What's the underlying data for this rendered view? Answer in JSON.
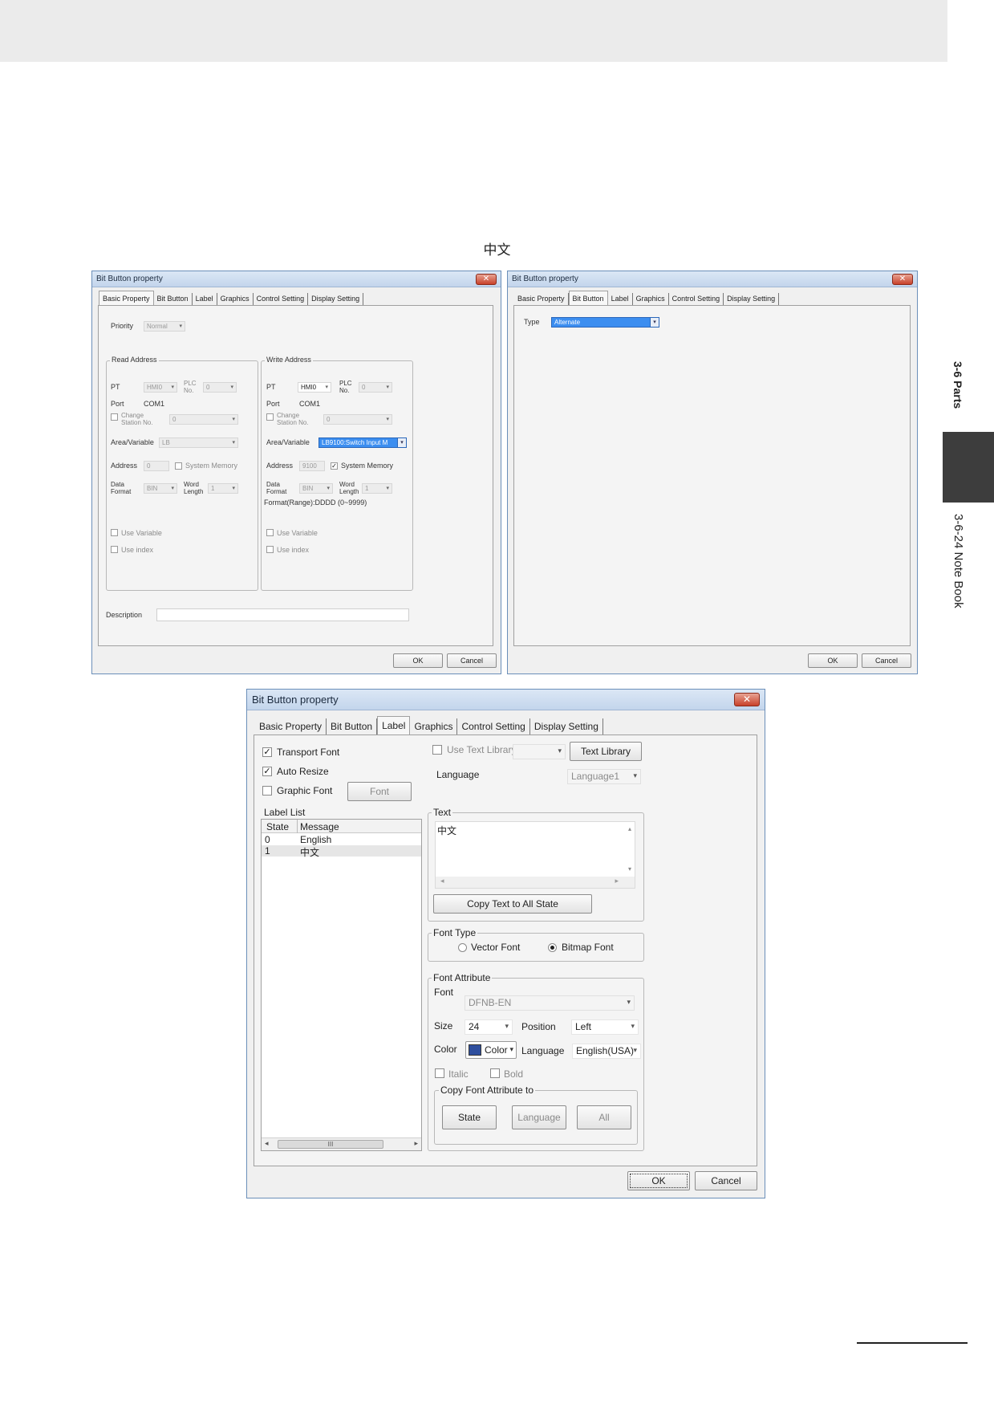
{
  "side": {
    "section": "3-6 Parts",
    "subsection": "3-6-24 Note Book"
  },
  "caption": "中文",
  "dlg1": {
    "title": "Bit Button property",
    "tabs": [
      "Basic Property",
      "Bit Button",
      "Label",
      "Graphics",
      "Control Setting",
      "Display Setting"
    ],
    "priority_label": "Priority",
    "priority_value": "Normal",
    "read": {
      "title": "Read Address",
      "pt": "PT",
      "pt_value": "HMI0",
      "plc_no_1": "PLC",
      "plc_no_2": "No.",
      "plc_value": "0",
      "port": "Port",
      "port_value": "COM1",
      "change_1": "Change",
      "change_2": "Station No.",
      "change_value": "0",
      "area": "Area/Variable",
      "area_value": "LB",
      "address": "Address",
      "address_value": "0",
      "sysmem": "System Memory",
      "data_1": "Data",
      "data_2": "Format",
      "data_value": "BIN",
      "word_1": "Word",
      "word_2": "Length",
      "word_value": "1",
      "use_variable": "Use Variable",
      "use_index": "Use index"
    },
    "write": {
      "title": "Write Address",
      "pt": "PT",
      "pt_value": "HMI0",
      "plc_no_1": "PLC",
      "plc_no_2": "No.",
      "plc_value": "0",
      "port": "Port",
      "port_value": "COM1",
      "change_1": "Change",
      "change_2": "Station No.",
      "change_value": "0",
      "area": "Area/Variable",
      "area_value": "LB9100:Switch Input M",
      "address": "Address",
      "address_value": "9100",
      "sysmem": "System Memory",
      "data_1": "Data",
      "data_2": "Format",
      "data_value": "BIN",
      "word_1": "Word",
      "word_2": "Length",
      "word_value": "1",
      "format_range": "Format(Range):DDDD (0~9999)",
      "use_variable": "Use Variable",
      "use_index": "Use index"
    },
    "description": "Description",
    "ok": "OK",
    "cancel": "Cancel"
  },
  "dlg2": {
    "title": "Bit Button property",
    "tabs": [
      "Basic Property",
      "Bit Button",
      "Label",
      "Graphics",
      "Control Setting",
      "Display Setting"
    ],
    "type_label": "Type",
    "type_value": "Alternate",
    "ok": "OK",
    "cancel": "Cancel"
  },
  "dlg3": {
    "title": "Bit Button property",
    "tabs": [
      "Basic Property",
      "Bit Button",
      "Label",
      "Graphics",
      "Control Setting",
      "Display Setting"
    ],
    "transport_font": "Transport Font",
    "auto_resize": "Auto Resize",
    "graphic_font": "Graphic Font",
    "font_btn": "Font",
    "label_list": "Label List",
    "col_state": "State",
    "col_message": "Message",
    "rows": [
      {
        "state": "0",
        "message": "English"
      },
      {
        "state": "1",
        "message": "中文"
      }
    ],
    "scroll_thumb": "III",
    "use_text_library": "Use Text Library",
    "text_library": "Text Library",
    "language_label": "Language",
    "language_value": "Language1",
    "text_group": "Text",
    "text_value": "中文",
    "copy_text": "Copy Text to All State",
    "font_type": "Font Type",
    "vector_font": "Vector Font",
    "bitmap_font": "Bitmap Font",
    "font_attribute": "Font Attribute",
    "font_label": "Font",
    "font_value": "DFNB-EN",
    "size_label": "Size",
    "size_value": "24",
    "position_label": "Position",
    "position_value": "Left",
    "color_label": "Color",
    "color_btn": "Color",
    "color_swatch": "#2f4f9e",
    "lang_label": "Language",
    "lang_value": "English(USA)",
    "italic": "Italic",
    "bold": "Bold",
    "copy_attr": "Copy Font Attribute to",
    "btn_state": "State",
    "btn_language": "Language",
    "btn_all": "All",
    "ok": "OK",
    "cancel": "Cancel"
  }
}
